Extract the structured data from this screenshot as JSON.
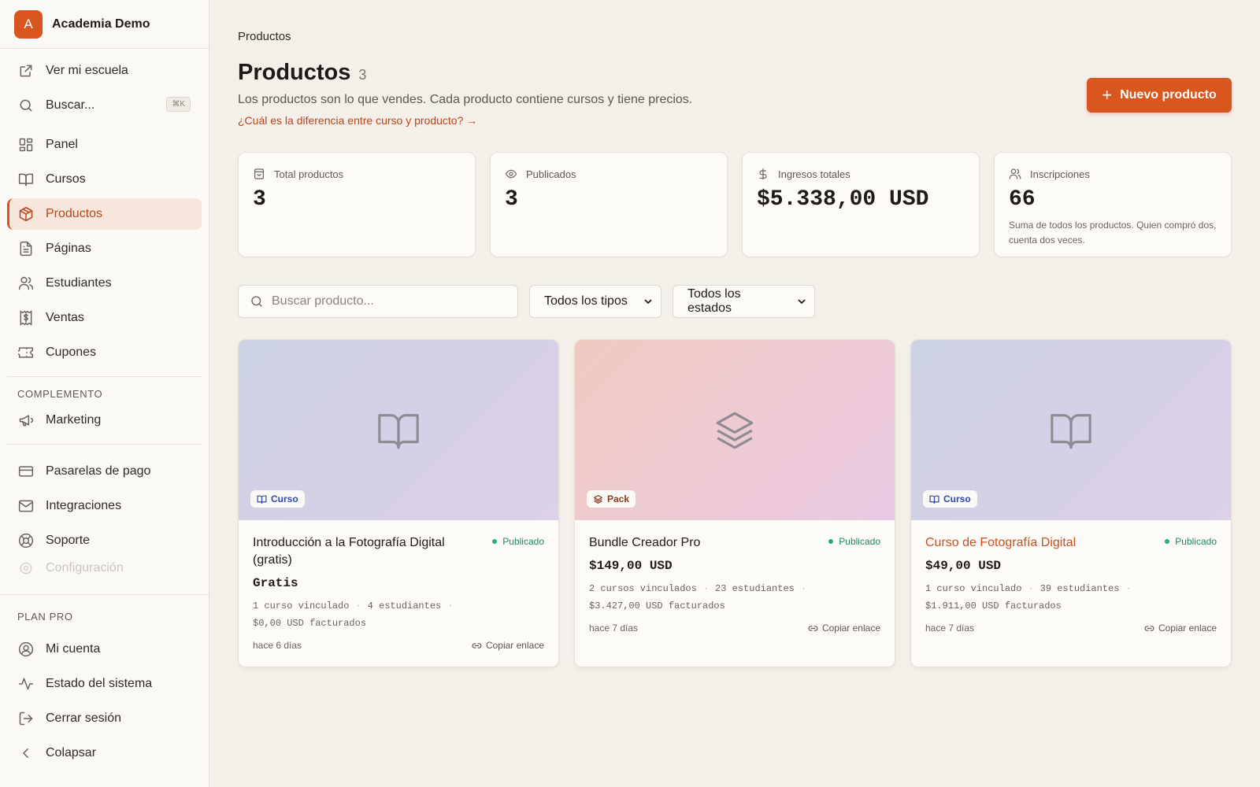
{
  "brand": {
    "initial": "A",
    "name": "Academia Demo"
  },
  "sidebar": {
    "top": [
      {
        "label": "Ver mi escuela"
      },
      {
        "label": "Buscar...",
        "shortcut": "⌘K"
      }
    ],
    "main": [
      {
        "label": "Panel"
      },
      {
        "label": "Cursos"
      },
      {
        "label": "Productos",
        "active": true
      },
      {
        "label": "Páginas"
      },
      {
        "label": "Estudiantes"
      },
      {
        "label": "Ventas"
      },
      {
        "label": "Cupones"
      }
    ],
    "complement_label": "COMPLEMENTO",
    "complement": [
      {
        "label": "Marketing"
      }
    ],
    "settings": [
      {
        "label": "Pasarelas de pago"
      },
      {
        "label": "Integraciones"
      },
      {
        "label": "Soporte"
      },
      {
        "label": "Configuración"
      }
    ],
    "plan_label": "PLAN PRO",
    "bottom": [
      {
        "label": "Mi cuenta"
      },
      {
        "label": "Estado del sistema"
      },
      {
        "label": "Cerrar sesión"
      },
      {
        "label": "Colapsar"
      }
    ]
  },
  "header": {
    "breadcrumb": "Productos",
    "title": "Productos",
    "count": "3",
    "subtitle": "Los productos son lo que vendes. Cada producto contiene cursos y tiene precios.",
    "help_link": "¿Cuál es la diferencia entre curso y producto? →",
    "new_button": "Nuevo producto"
  },
  "stats": [
    {
      "label": "Total productos",
      "value": "3",
      "icon": "bag-icon"
    },
    {
      "label": "Publicados",
      "value": "3",
      "icon": "eye-icon"
    },
    {
      "label": "Ingresos totales",
      "value": "$5.338,00 USD",
      "icon": "dollar-icon"
    },
    {
      "label": "Inscripciones",
      "value": "66",
      "icon": "users-icon",
      "note": "Suma de todos los productos. Quien compró dos, cuenta dos veces."
    }
  ],
  "filters": {
    "search_placeholder": "Buscar producto...",
    "type_select": "Todos los tipos",
    "status_select": "Todos los estados"
  },
  "products": [
    {
      "type": "Curso",
      "title": "Introducción a la Fotografía Digital (gratis)",
      "status": "Publicado",
      "price": "Gratis",
      "courses": "1 curso vinculado",
      "students": "4 estudiantes",
      "billed": "$0,00 USD facturados",
      "age": "hace 6 días",
      "copy": "Copiar enlace"
    },
    {
      "type": "Pack",
      "title": "Bundle Creador Pro",
      "status": "Publicado",
      "price": "$149,00 USD",
      "courses": "2 cursos vinculados",
      "students": "23 estudiantes",
      "billed": "$3.427,00 USD facturados",
      "age": "hace 7 días",
      "copy": "Copiar enlace"
    },
    {
      "type": "Curso",
      "title": "Curso de Fotografía Digital",
      "status": "Publicado",
      "price": "$49,00 USD",
      "courses": "1 curso vinculado",
      "students": "39 estudiantes",
      "billed": "$1.911,00 USD facturados",
      "age": "hace 7 días",
      "copy": "Copiar enlace"
    }
  ],
  "colors": {
    "accent": "#d9561f",
    "background": "#f4efe9",
    "published": "#22b07a"
  }
}
